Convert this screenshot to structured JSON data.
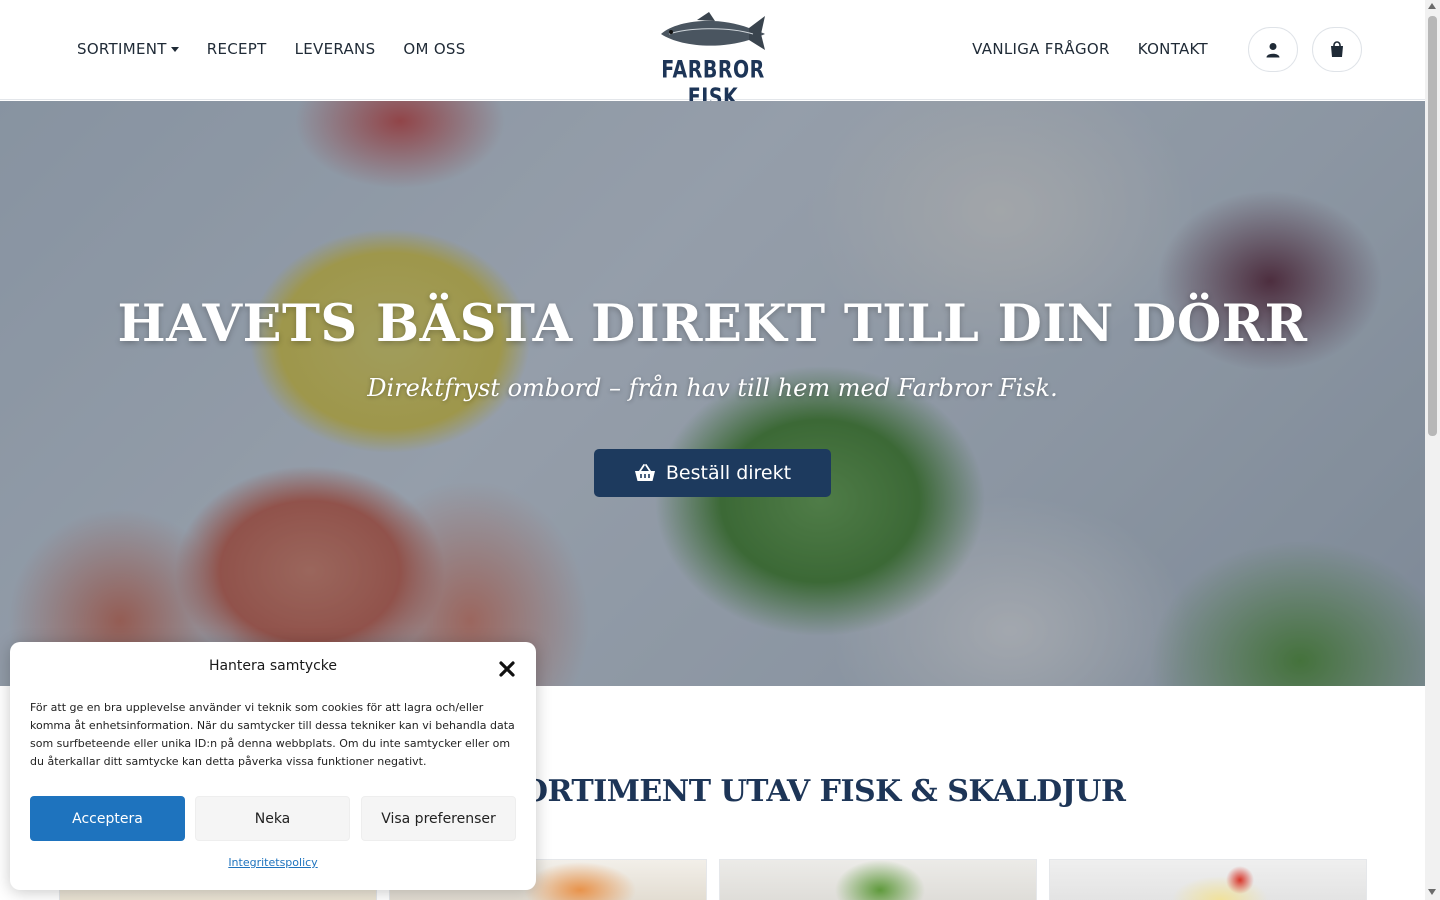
{
  "header": {
    "nav_left": [
      "SORTIMENT",
      "RECEPT",
      "LEVERANS",
      "OM OSS"
    ],
    "nav_right": [
      "VANLIGA FRÅGOR",
      "KONTAKT"
    ],
    "logo_text": "FARBROR FISK",
    "account_icon": "user-icon",
    "cart_icon": "shopping-bag-icon"
  },
  "hero": {
    "title": "HAVETS BÄSTA DIREKT TILL DIN DÖRR",
    "subtitle": "Direktfryst ombord – från hav till hem med Farbror Fisk.",
    "button_label": "Beställ direkt",
    "button_icon": "basket-icon"
  },
  "section": {
    "title": "ETT BRETT SORTIMENT UTAV FISK & SKALDJUR"
  },
  "consent": {
    "title": "Hantera samtycke",
    "body": "För att ge en bra upplevelse använder vi teknik som cookies för att lagra och/eller komma åt enhetsinformation. När du samtycker till dessa tekniker kan vi behandla data som surfbeteende eller unika ID:n på denna webbplats. Om du inte samtycker eller om du återkallar ditt samtycke kan detta påverka vissa funktioner negativt.",
    "accept_label": "Acceptera",
    "deny_label": "Neka",
    "prefs_label": "Visa preferenser",
    "policy_label": "Integritetspolicy"
  },
  "colors": {
    "brand_navy": "#1d3557",
    "button_navy": "#1d3a5e",
    "accept_blue": "#1e73be"
  }
}
